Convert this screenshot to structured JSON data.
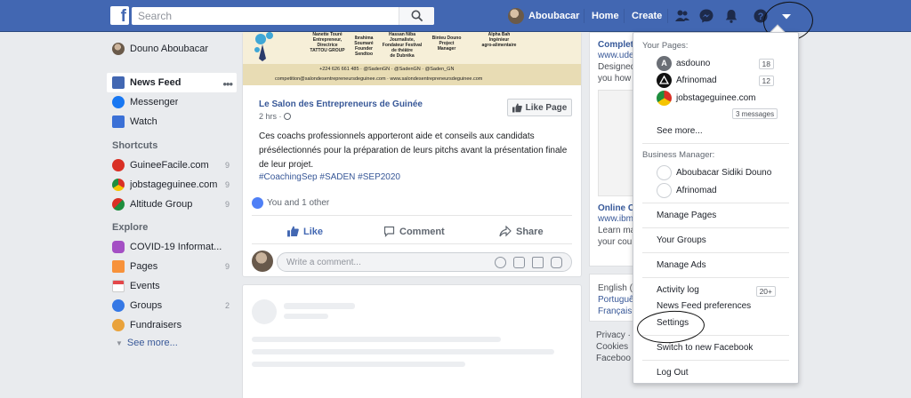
{
  "topbar": {
    "logo_letter": "f",
    "search_placeholder": "Search",
    "user_name": "Aboubacar",
    "home_label": "Home",
    "create_label": "Create",
    "brand_color": "#4267b2"
  },
  "sidebar": {
    "profile_name": "Douno Aboubacar",
    "main_items": [
      {
        "label": "News Feed",
        "icon": "news-feed-icon"
      },
      {
        "label": "Messenger",
        "icon": "messenger-icon"
      },
      {
        "label": "Watch",
        "icon": "watch-icon"
      }
    ],
    "shortcuts_title": "Shortcuts",
    "shortcuts": [
      {
        "label": "GuineeFacile.com",
        "count": "9"
      },
      {
        "label": "jobstageguinee.com",
        "count": "9"
      },
      {
        "label": "Altitude Group",
        "count": "9"
      }
    ],
    "explore_title": "Explore",
    "explore": [
      {
        "label": "COVID-19 Informat...",
        "count": ""
      },
      {
        "label": "Pages",
        "count": "9"
      },
      {
        "label": "Events",
        "count": ""
      },
      {
        "label": "Groups",
        "count": "2"
      },
      {
        "label": "Fundraisers",
        "count": ""
      }
    ],
    "see_more": "See more..."
  },
  "banner": {
    "people": [
      "Nanette Touré\nEntrepreneur,\nDirectrice\nTATTOU GROUP",
      "Ibrahima\nSoumaré\nFounder\nSendtoo",
      "Hassan Niba\nJournaliste,\nFondateur Festival\nde théâtre\nde Dubréka",
      "Binteu Douno\nProject\nManager",
      "Alpha Bah\nIngénieur\nagro-alimentaire"
    ],
    "phone_line": "+224 626 661 485  ·  @SadenGN  ·  @SadenGN  ·  @Saden_GN",
    "contact_line": "competition@salondesentrepreneursdeguinee.com  ·  www.salondesentrepreneursdeguinee.com"
  },
  "post": {
    "page_name": "Le Salon des Entrepreneurs de Guinée",
    "time": "2 hrs ·",
    "like_page_label": "Like Page",
    "body": "Ces coachs professionnels apporteront aide et conseils aux candidats présélectionnés pour la préparation de leurs pitchs avant la présentation finale de leur projet.",
    "hashtags": "#CoachingSep #SADEN #SEP2020",
    "reactions_text": "You and 1 other",
    "like_label": "Like",
    "comment_label": "Comment",
    "share_label": "Share",
    "comment_placeholder": "Write a comment..."
  },
  "right_column": {
    "card1_title": "Complet",
    "card1_link": "www.ude",
    "card1_text1": "Designed",
    "card1_text2": "you how",
    "card2_title": "Online C",
    "card2_link": "www.ibm",
    "card2_text1": "Learn ma",
    "card2_text2": "your cou",
    "lang1": "English (",
    "lang2": "Portuguê",
    "lang3": "Français",
    "footer1": "Privacy ·",
    "footer2": "Cookies",
    "footer3": "Faceboo"
  },
  "dropdown": {
    "your_pages_title": "Your Pages:",
    "pages": [
      {
        "name": "asdouno",
        "initial": "A",
        "badge": "18"
      },
      {
        "name": "Afrinomad",
        "initial": "",
        "badge": "12"
      },
      {
        "name": "jobstageguinee.com",
        "initial": "",
        "badge": ""
      }
    ],
    "messages_badge": "3 messages",
    "see_more": "See more...",
    "business_manager_title": "Business Manager:",
    "business_accounts": [
      "Aboubacar Sidiki Douno",
      "Afrinomad"
    ],
    "manage_pages": "Manage Pages",
    "your_groups": "Your Groups",
    "manage_ads": "Manage Ads",
    "activity_log": "Activity log",
    "activity_badge": "20+",
    "news_feed_prefs": "News Feed preferences",
    "settings": "Settings",
    "switch_new": "Switch to new Facebook",
    "log_out": "Log Out"
  }
}
